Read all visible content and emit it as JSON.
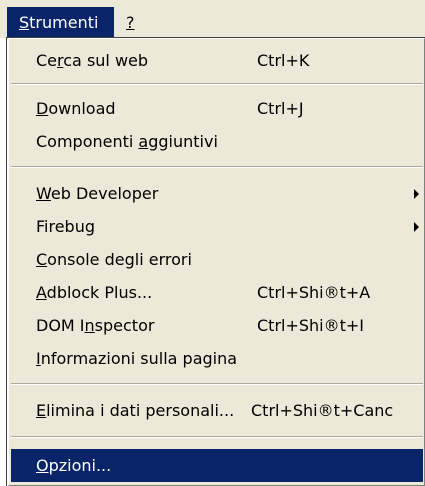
{
  "menubar": {
    "items": [
      {
        "label_before": "",
        "accel": "S",
        "label_after": "trumenti"
      },
      {
        "label_before": "",
        "accel": "?",
        "label_after": ""
      }
    ]
  },
  "menu": {
    "items": [
      {
        "before": "Ce",
        "accel": "r",
        "after": "ca sul web",
        "shortcut": "Ctrl+K"
      },
      {
        "before": "",
        "accel": "D",
        "after": "ownload",
        "shortcut": "Ctrl+J"
      },
      {
        "before": "Componenti ",
        "accel": "a",
        "after": "ggiuntivi",
        "shortcut": ""
      },
      {
        "before": "",
        "accel": "W",
        "after": "eb Developer",
        "shortcut": ""
      },
      {
        "before": "Firebug",
        "accel": "",
        "after": "",
        "shortcut": ""
      },
      {
        "before": "",
        "accel": "C",
        "after": "onsole degli errori",
        "shortcut": ""
      },
      {
        "before": "",
        "accel": "A",
        "after": "dblock Plus...",
        "shortcut": "Ctrl+Shi®t+A"
      },
      {
        "before": "DOM I",
        "accel": "n",
        "after": "spector",
        "shortcut": "Ctrl+Shi®t+I"
      },
      {
        "before": "",
        "accel": "I",
        "after": "nformazioni sulla pagina",
        "shortcut": ""
      },
      {
        "before": "",
        "accel": "E",
        "after": "limina i dati personali...",
        "shortcut": "Ctrl+Shi®t+Canc"
      },
      {
        "before": "",
        "accel": "O",
        "after": "pzioni...",
        "shortcut": ""
      }
    ]
  },
  "colors": {
    "highlight": "#0a246a",
    "menu_bg": "#ece9d8"
  }
}
